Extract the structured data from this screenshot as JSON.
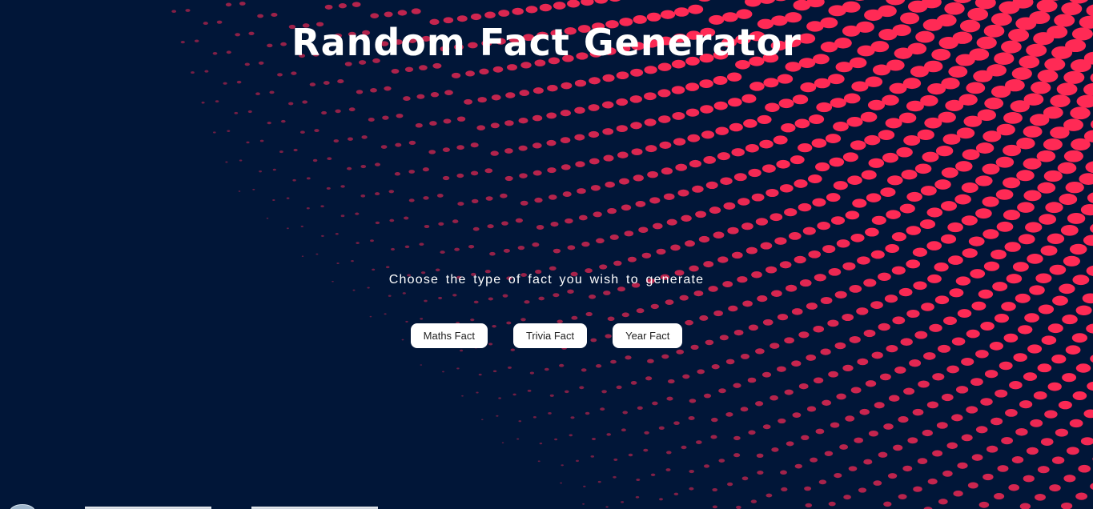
{
  "page": {
    "title": "Random Fact Generator",
    "prompt": "Choose the type of fact you wish to generate"
  },
  "buttons": [
    {
      "label": "Maths Fact"
    },
    {
      "label": "Trivia Fact"
    },
    {
      "label": "Year Fact"
    }
  ],
  "theme": {
    "background": "#011638",
    "dot_color": "#ff2a55",
    "text_color": "#ffffff",
    "button_bg": "#ffffff"
  },
  "taskbar": {
    "icons": [
      "start-orb-icon"
    ]
  }
}
